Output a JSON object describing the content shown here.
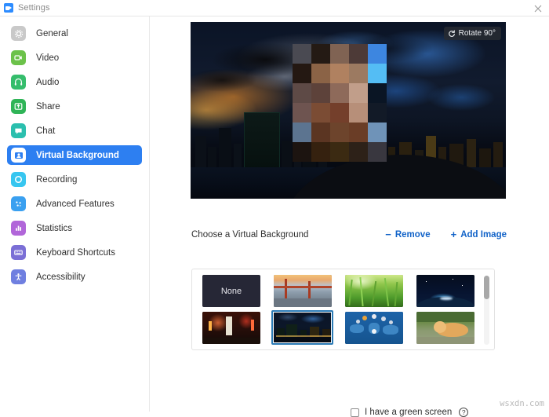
{
  "window": {
    "title": "Settings",
    "logo_icon": "zoom-camera-icon",
    "close_icon": "close-icon"
  },
  "sidebar": {
    "items": [
      {
        "label": "General",
        "icon": "gear-icon",
        "color": "#c9c9c9",
        "active": false
      },
      {
        "label": "Video",
        "icon": "video-camera-icon",
        "color": "#6cc24a",
        "active": false
      },
      {
        "label": "Audio",
        "icon": "headset-icon",
        "color": "#35bd6c",
        "active": false
      },
      {
        "label": "Share",
        "icon": "share-screen-icon",
        "color": "#2fb457",
        "active": false
      },
      {
        "label": "Chat",
        "icon": "chat-bubble-icon",
        "color": "#2bbfae",
        "active": false
      },
      {
        "label": "Virtual Background",
        "icon": "person-card-icon",
        "color": "#2d7ff1",
        "active": true
      },
      {
        "label": "Recording",
        "icon": "record-circle-icon",
        "color": "#37c6f0",
        "active": false
      },
      {
        "label": "Advanced Features",
        "icon": "sparkle-icon",
        "color": "#3aa0f0",
        "active": false
      },
      {
        "label": "Statistics",
        "icon": "bar-chart-icon",
        "color": "#b166d9",
        "active": false
      },
      {
        "label": "Keyboard Shortcuts",
        "icon": "keyboard-icon",
        "color": "#7b6fd6",
        "active": false
      },
      {
        "label": "Accessibility",
        "icon": "accessibility-icon",
        "color": "#6f7fe0",
        "active": false
      }
    ]
  },
  "preview": {
    "rotate_button": {
      "label": "Rotate 90°",
      "icon": "rotate-icon"
    },
    "description": "Live camera preview with city skyline virtual background and pixelated face",
    "mosaic_rows": [
      [
        "#4a4a52",
        "#241a14",
        "#806353",
        "#4d3a37",
        "#3d86e0"
      ],
      [
        "#241812",
        "#8b6346",
        "#b08160",
        "#9c7a61",
        "#54bdf4"
      ],
      [
        "#5e4a46",
        "#5d423a",
        "#8e6a5a",
        "#c19e8a",
        "#0a1524"
      ],
      [
        "#6e5450",
        "#7b4c34",
        "#743f2b",
        "#b78f79",
        "#121a27"
      ],
      [
        "#5c7490",
        "#5b3522",
        "#6d442c",
        "#6a3d26",
        "#6f93b8"
      ],
      [
        "#1c1410",
        "#35210f",
        "#3b2a12",
        "#2d2118",
        "#39373f"
      ]
    ]
  },
  "choose": {
    "label": "Choose a Virtual Background",
    "remove": {
      "label": "Remove",
      "sign": "−",
      "icon": "minus-icon"
    },
    "add_image": {
      "label": "Add Image",
      "sign": "+",
      "icon": "plus-icon"
    }
  },
  "thumbnails": [
    {
      "name": "None",
      "kind": "none",
      "selected": false
    },
    {
      "name": "Golden Gate Bridge",
      "kind": "bridge",
      "selected": false
    },
    {
      "name": "Grass",
      "kind": "grass",
      "selected": false
    },
    {
      "name": "Earth from Space",
      "kind": "earth",
      "selected": false
    },
    {
      "name": "City Street Night",
      "kind": "street",
      "selected": false
    },
    {
      "name": "City Skyline Night",
      "kind": "skyline",
      "selected": true
    },
    {
      "name": "World Network Map",
      "kind": "network",
      "selected": false
    },
    {
      "name": "Dog on Grass",
      "kind": "dog",
      "selected": false
    }
  ],
  "scrollbar": {
    "name": "thumbnail-scrollbar"
  },
  "green_screen": {
    "label": "I have a green screen",
    "checked": false,
    "help_icon": "question-mark-icon",
    "help_glyph": "?"
  },
  "watermark": "wsxdn.com",
  "colors": {
    "accent": "#2d7ff1",
    "link": "#1263c8",
    "selected_border": "#2a7ab5",
    "text": "#2f2f2f"
  }
}
